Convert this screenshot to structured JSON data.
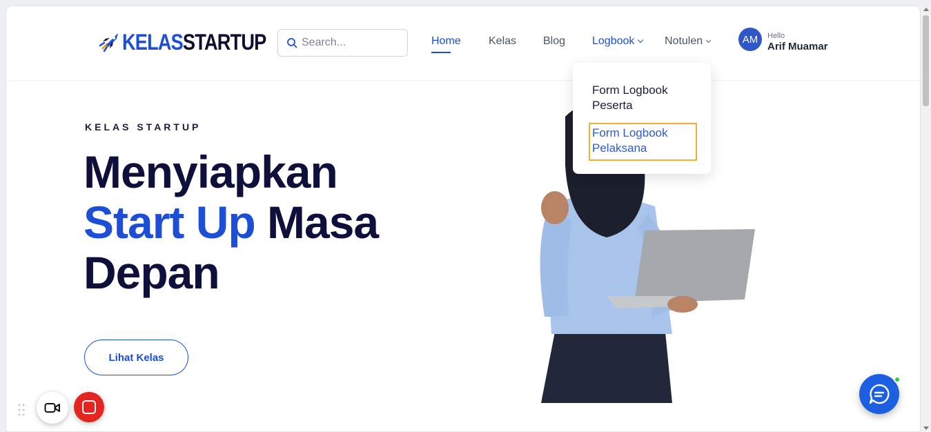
{
  "brand": {
    "logo_blue": "KELAS",
    "logo_dark": "STARTUP",
    "accent": "#1c4fd6",
    "dark": "#0e0f3a"
  },
  "search": {
    "placeholder": "Search..."
  },
  "nav": {
    "home": "Home",
    "kelas": "Kelas",
    "blog": "Blog",
    "logbook": "Logbook",
    "notulen": "Notulen"
  },
  "user": {
    "initials": "AM",
    "greeting": "Hello",
    "name": "Arif Muamar"
  },
  "logbook_menu": {
    "item1": "Form Logbook Peserta",
    "item2": "Form Logbook Pelaksana"
  },
  "hero": {
    "eyebrow": "KELAS STARTUP",
    "line1": "Menyiapkan",
    "line2_blue": "Start Up",
    "line2_dark": "Masa",
    "line3": "Depan",
    "cta": "Lihat Kelas"
  },
  "icons": {
    "logo": "rocket-icon",
    "search": "search-icon",
    "chat": "chat-bubble-icon",
    "camera": "video-camera-icon",
    "stop": "stop-icon",
    "drag": "drag-handle-icon"
  }
}
